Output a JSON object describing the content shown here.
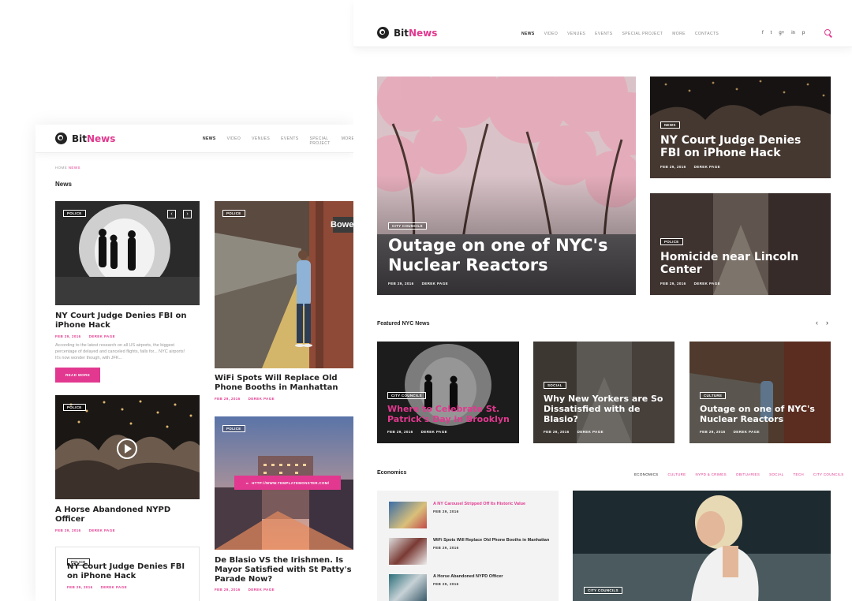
{
  "brand": {
    "part1": "Bit",
    "part2": "News"
  },
  "nav": [
    "News",
    "Video",
    "Venues",
    "Events",
    "Special Project",
    "More",
    "Contacts"
  ],
  "mobile": {
    "nav": [
      "News",
      "Video",
      "Venues",
      "Events",
      "Special Project",
      "More"
    ],
    "breadcrumb": {
      "home": "HOME",
      "current": "NEWS"
    },
    "section_title": "News",
    "card1": {
      "tag": "POLICE",
      "title": "NY Court Judge Denies FBI on iPhone Hack",
      "date": "FEB 29, 2016",
      "author": "DEREK PAGE",
      "excerpt": "According to the latest research on all US airports, the biggest percentage of delayed and canceled flights, falls for... NYC airports! It's now wonder though, with JFK...",
      "button": "READ MORE"
    },
    "card2": {
      "tag": "POLICE",
      "title": "WiFi Spots Will Replace Old Phone Booths in Manhattan",
      "date": "FEB 29, 2016",
      "author": "DEREK PAGE",
      "sign": "Bowe"
    },
    "card3": {
      "tag": "POLICE",
      "title": "A Horse Abandoned NYPD Officer",
      "date": "FEB 29, 2016",
      "author": "DEREK PAGE"
    },
    "card4": {
      "tag": "POLICE",
      "title": "De Blasio VS the Irishmen. Is Mayor Satisfied with St Patty's Parade Now?",
      "date": "FEB 29, 2016",
      "author": "DEREK PAGE",
      "link": "HTTP://WWW.TEMPLATEMONSTER.COM/"
    },
    "card5": {
      "tag": "POLICE",
      "title": "NY Court Judge Denies FBI on iPhone Hack",
      "date": "FEB 29, 2016",
      "author": "DEREK PAGE"
    }
  },
  "social": [
    "f",
    "t",
    "g+",
    "in",
    "p"
  ],
  "hero_main": {
    "tag": "CITY COUNCILS",
    "title": "Outage on one of NYC's Nuclear Reactors",
    "date": "FEB 29, 2016",
    "author": "DEREK PAGE"
  },
  "hero_side1": {
    "tag": "NEWS",
    "title": "NY Court Judge Denies FBI on iPhone Hack",
    "date": "FEB 29, 2016",
    "author": "DEREK PAGE"
  },
  "hero_side2": {
    "tag": "POLICE",
    "title": "Homicide near Lincoln Center",
    "date": "FEB 29, 2016",
    "author": "DEREK PAGE"
  },
  "featured": {
    "title": "Featured NYC News",
    "items": [
      {
        "tag": "CITY COUNCILS",
        "title": "Where to Celebrate St. Patrick's Day in Brooklyn",
        "date": "FEB 29, 2016",
        "author": "DEREK PAGE"
      },
      {
        "tag": "SOCIAL",
        "title": "Why New Yorkers are So Dissatisfied with de Blasio?",
        "date": "FEB 29, 2016",
        "author": "DEREK PAGE"
      },
      {
        "tag": "CULTURE",
        "title": "Outage on one of NYC's Nuclear Reactors",
        "date": "FEB 29, 2016",
        "author": "DEREK PAGE"
      }
    ]
  },
  "economics": {
    "title": "Economics",
    "categories": [
      "Economics",
      "Culture",
      "NYPD & Crimes",
      "Obituaries",
      "Social",
      "Tech",
      "City Councils"
    ],
    "list": [
      {
        "title": "A NY Carousel Stripped Off Its Historic Value",
        "date": "FEB 29, 2016"
      },
      {
        "title": "WiFi Spots Will Replace Old Phone Booths in Manhattan",
        "date": "FEB 29, 2016"
      },
      {
        "title": "A Horse Abandoned NYPD Officer",
        "date": "FEB 29, 2016"
      }
    ],
    "big_tag": "CITY COUNCILS"
  },
  "colors": {
    "accent": "#e2388f",
    "dark": "#222222"
  }
}
